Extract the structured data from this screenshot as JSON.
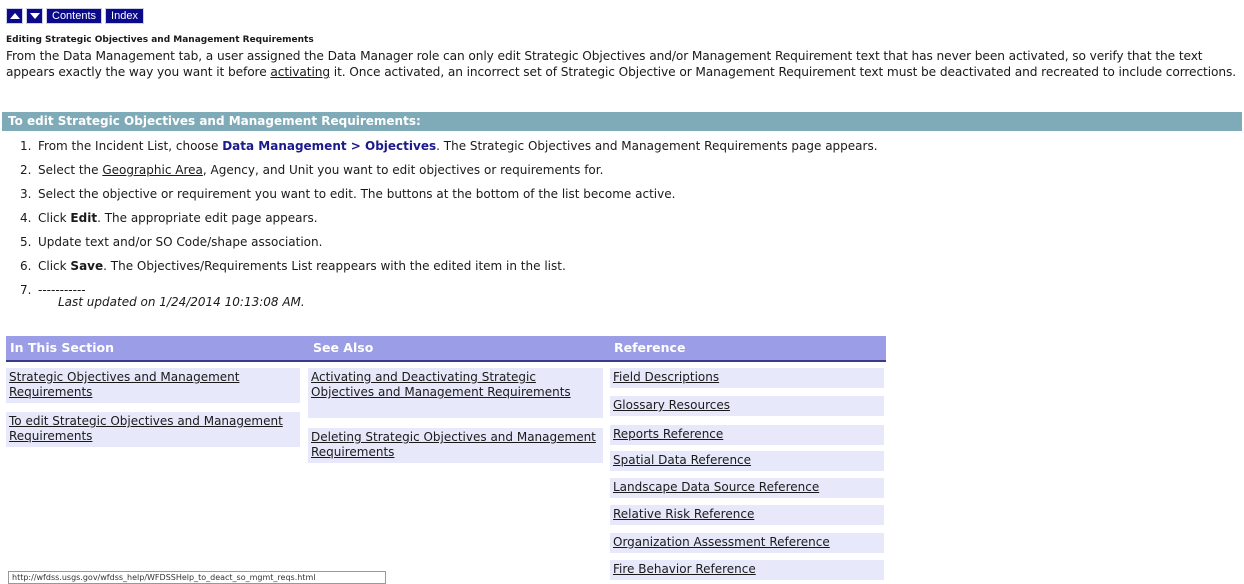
{
  "nav": {
    "up_icon": "triangle-up-icon",
    "down_icon": "triangle-down-icon",
    "contents": "Contents",
    "index": "Index"
  },
  "heading": "Editing Strategic Objectives and Management Requirements",
  "intro": {
    "before": "From the Data Management tab, a user assigned the Data Manager role can only edit Strategic Objectives and/or Management Requirement text that has never been activated, so verify that the text appears exactly the way you want it before ",
    "link": "activating",
    "after": " it. Once activated, an incorrect set of Strategic Objective or Management Requirement text must be deactivated and recreated to include corrections."
  },
  "procedure_title": "To edit Strategic Objectives and Management Requirements:",
  "steps": [
    {
      "num": "1.",
      "a": "From the Incident List, choose ",
      "b": "Data Management > Objectives",
      "c": ". The Strategic Objectives and Management Requirements page appears."
    },
    {
      "num": "2.",
      "a": "Select the ",
      "link": "Geographic Area",
      "c": ", Agency, and Unit you want to edit objectives or requirements for."
    },
    {
      "num": "3.",
      "a": "Select the objective or requirement you want to edit. The buttons at the bottom of the list become active."
    },
    {
      "num": "4.",
      "a": "Click ",
      "b": "Edit",
      "c": ". The appropriate edit page appears."
    },
    {
      "num": "5.",
      "a": "Update text and/or SO Code/shape association."
    },
    {
      "num": "6.",
      "a": "Click ",
      "b": "Save",
      "c": ". The Objectives/Requirements List reappears with the edited item in the list."
    },
    {
      "num": "7.",
      "a": "-----------"
    }
  ],
  "last_updated": "Last updated on 1/24/2014 10:13:08 AM.",
  "table": {
    "headers": [
      "In This Section",
      "See Also",
      "Reference"
    ],
    "in_this_section": [
      "Strategic Objectives and Management Requirements",
      "To edit Strategic Objectives and Management Requirements"
    ],
    "see_also": [
      "Activating and Deactivating Strategic Objectives and Management Requirements",
      "Deleting Strategic Objectives and Management Requirements"
    ],
    "reference": [
      "Field Descriptions",
      "Glossary Resources",
      "Reports Reference",
      "Spatial Data Reference",
      "Landscape Data Source Reference",
      "Relative Risk Reference",
      "Organization Assessment Reference",
      "Fire Behavior Reference"
    ]
  },
  "status_url": "http://wfdss.usgs.gov/wfdss_help/WFDSSHelp_to_deact_so_mgmt_reqs.html"
}
